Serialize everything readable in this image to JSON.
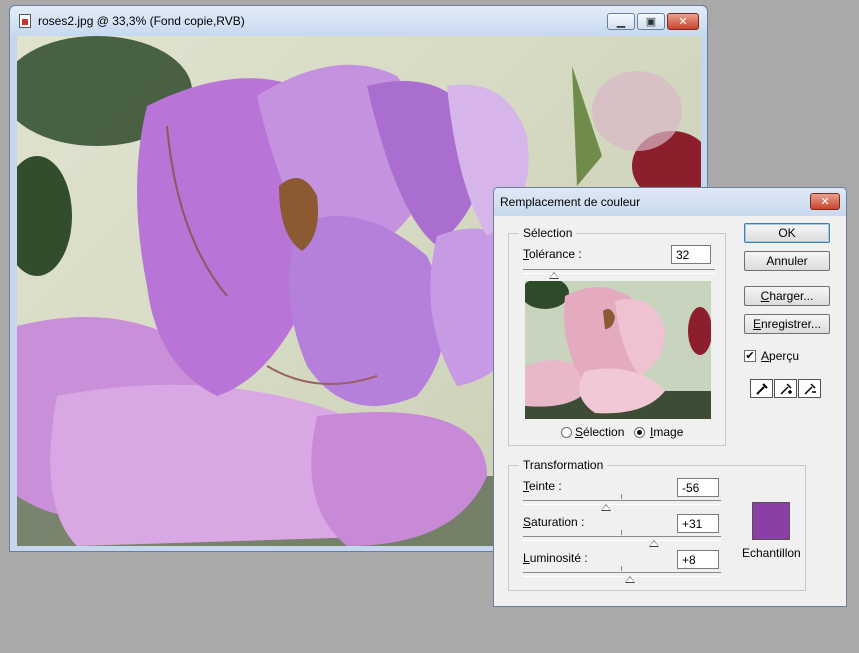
{
  "document_window": {
    "title": "roses2.jpg @ 33,3% (Fond copie,RVB)",
    "controls": [
      "minimize",
      "maximize",
      "close"
    ]
  },
  "dialog": {
    "title": "Remplacement de couleur",
    "selection_group": {
      "legend": "Sélection",
      "tolerance_label_accel": "T",
      "tolerance_label_rest": "olérance :",
      "tolerance_value": "32",
      "tolerance_slider_level": 0.16,
      "radio_selection_accel": "S",
      "radio_selection_rest": "élection",
      "radio_image_accel": "I",
      "radio_image_rest": "mage",
      "selected_radio": "image"
    },
    "buttons": {
      "ok": "OK",
      "cancel": "Annuler",
      "load_accel": "C",
      "load_rest": "harger...",
      "save_accel": "E",
      "save_rest": "nregistrer..."
    },
    "preview_checkbox": {
      "accel": "A",
      "rest": "perçu",
      "checked": true,
      "check_glyph": "✔"
    },
    "eyedroppers": [
      "eyedropper-icon",
      "eyedropper-add-icon",
      "eyedropper-subtract-icon"
    ],
    "transformation_group": {
      "legend": "Transformation",
      "hue_accel": "T",
      "hue_rest": "einte :",
      "hue_value": "-56",
      "hue_slider_level": 0.42,
      "saturation_accel": "S",
      "saturation_rest": "aturation :",
      "saturation_value": "+31",
      "saturation_slider_level": 0.66,
      "lightness_accel": "L",
      "lightness_rest": "uminosité :",
      "lightness_value": "+8",
      "lightness_slider_level": 0.54,
      "sample_label": "Echantillon",
      "sample_color": "#8a3fa6"
    }
  },
  "colors": {
    "desktop": "#a9a9a9",
    "rose_petal": "#c07fd6",
    "preview_petal": "#e7b7c8"
  }
}
